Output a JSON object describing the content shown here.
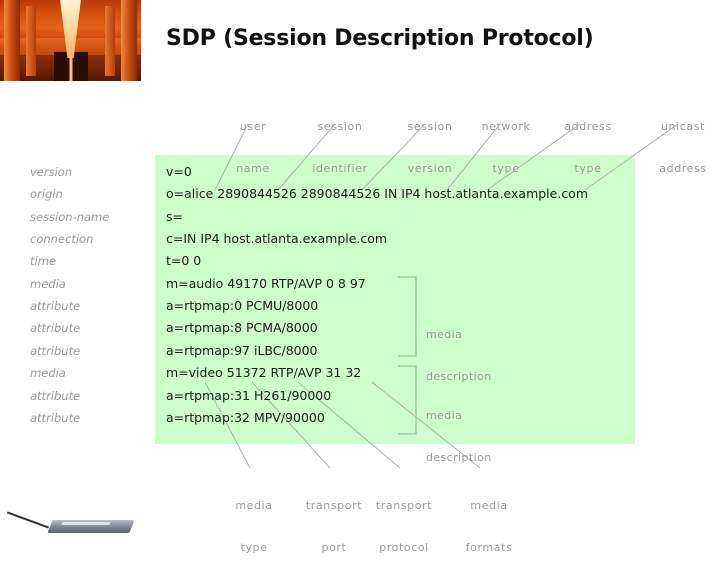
{
  "slide": {
    "title": "SDP (Session Description Protocol)",
    "panel_color": "#ccffcc",
    "label_color": "#9a9a9a",
    "text_color": "#1a1a1a"
  },
  "photos": {
    "top_left": "orange-corridor-photo",
    "bottom_left": "laptop-photo"
  },
  "top_callouts": [
    {
      "line1": "user",
      "line2": "name"
    },
    {
      "line1": "session",
      "line2": "identifier"
    },
    {
      "line1": "session",
      "line2": "version"
    },
    {
      "line1": "network",
      "line2": "type"
    },
    {
      "line1": "address",
      "line2": "type"
    },
    {
      "line1": "unicast",
      "line2": "address"
    }
  ],
  "bottom_callouts": [
    {
      "line1": "media",
      "line2": "type"
    },
    {
      "line1": "transport",
      "line2": "port"
    },
    {
      "line1": "transport",
      "line2": "protocol"
    },
    {
      "line1": "media",
      "line2": "formats"
    }
  ],
  "side_callouts": [
    {
      "line1": "media",
      "line2": "description"
    },
    {
      "line1": "media",
      "line2": "description"
    }
  ],
  "rows": [
    {
      "label": "version",
      "text": "v=0"
    },
    {
      "label": "origin",
      "text": "o=alice 2890844526 2890844526 IN IP4 host.atlanta.example.com"
    },
    {
      "label": "session-name",
      "text": "s="
    },
    {
      "label": "connection",
      "text": "c=IN IP4 host.atlanta.example.com"
    },
    {
      "label": "time",
      "text": "t=0 0"
    },
    {
      "label": "media",
      "text": "m=audio 49170 RTP/AVP 0 8 97"
    },
    {
      "label": "attribute",
      "text": "a=rtpmap:0 PCMU/8000"
    },
    {
      "label": "attribute",
      "text": "a=rtpmap:8 PCMA/8000"
    },
    {
      "label": "attribute",
      "text": "a=rtpmap:97 iLBC/8000"
    },
    {
      "label": "media",
      "text": "m=video 51372 RTP/AVP 31 32"
    },
    {
      "label": "attribute",
      "text": "a=rtpmap:31 H261/90000"
    },
    {
      "label": "attribute",
      "text": "a=rtpmap:32 MPV/90000"
    }
  ]
}
